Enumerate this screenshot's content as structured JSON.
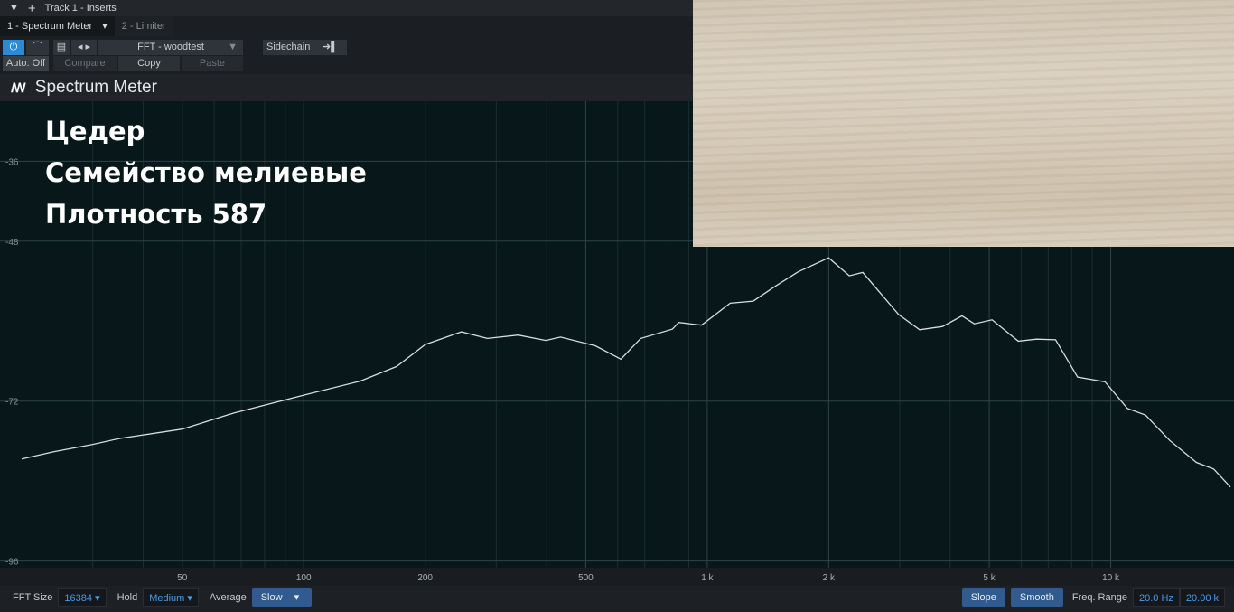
{
  "header": {
    "title": "Track 1 - Inserts"
  },
  "tabs": [
    {
      "label": "1 - Spectrum Meter"
    },
    {
      "label": "2 - Limiter"
    }
  ],
  "toolbar": {
    "preset": "FFT - woodtest",
    "sidechain": "Sidechain",
    "auto": "Auto: Off",
    "compare": "Compare",
    "copy": "Copy",
    "paste": "Paste"
  },
  "plugin": {
    "title": "Spectrum Meter"
  },
  "overlay": {
    "line1": "Цедер",
    "line2": "Семейство мелиевые",
    "line3": "Плотность 587"
  },
  "bottom": {
    "fft_label": "FFT Size",
    "fft_value": "16384",
    "hold_label": "Hold",
    "hold_value": "Medium",
    "avg_label": "Average",
    "avg_value": "Slow",
    "slope": "Slope",
    "smooth": "Smooth",
    "range_label": "Freq. Range",
    "range_min": "20.0 Hz",
    "range_max": "20.00 k"
  },
  "chart_data": {
    "type": "line",
    "xscale": "log",
    "xlim": [
      20,
      20000
    ],
    "ylim": [
      -97,
      -27
    ],
    "xticks": [
      {
        "v": 50,
        "label": "50"
      },
      {
        "v": 100,
        "label": "100"
      },
      {
        "v": 200,
        "label": "200"
      },
      {
        "v": 500,
        "label": "500"
      },
      {
        "v": 1000,
        "label": "1 k"
      },
      {
        "v": 2000,
        "label": "2 k"
      },
      {
        "v": 5000,
        "label": "5 k"
      },
      {
        "v": 10000,
        "label": "10 k"
      }
    ],
    "yticks": [
      {
        "v": -36,
        "label": "-36"
      },
      {
        "v": -48,
        "label": "-48"
      },
      {
        "v": -72,
        "label": "-72"
      },
      {
        "v": -96,
        "label": "-96"
      }
    ],
    "grid": true,
    "line_color": "#d8dde2",
    "x": [
      20,
      24,
      30,
      35,
      50,
      67,
      100,
      138,
      170,
      200,
      246,
      285,
      340,
      398,
      433,
      528,
      611,
      684,
      820,
      850,
      968,
      1140,
      1300,
      1480,
      1680,
      2000,
      2250,
      2430,
      2980,
      3360,
      3830,
      4280,
      4590,
      5080,
      5900,
      6550,
      7300,
      8280,
      9680,
      11000,
      12200,
      14000,
      16300,
      18000,
      19800
    ],
    "y": [
      -80.7,
      -79.6,
      -78.5,
      -77.6,
      -76.2,
      -73.8,
      -71.1,
      -69,
      -66.8,
      -63.5,
      -61.6,
      -62.6,
      -62.1,
      -62.9,
      -62.4,
      -63.7,
      -65.7,
      -62.6,
      -61.2,
      -60.2,
      -60.6,
      -57.3,
      -57,
      -54.7,
      -52.6,
      -50.5,
      -53.2,
      -52.7,
      -59,
      -61.3,
      -60.8,
      -59.2,
      -60.4,
      -59.8,
      -63,
      -62.7,
      -62.8,
      -68.4,
      -69.1,
      -73.1,
      -74.1,
      -77.9,
      -81.2,
      -82.2,
      -84.9
    ]
  }
}
